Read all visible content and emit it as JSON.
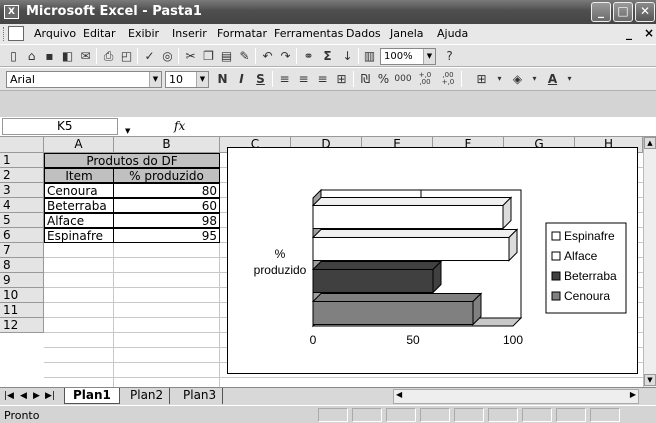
{
  "window": {
    "title": "Microsoft Excel - Pasta1",
    "app_icon": "excel-icon"
  },
  "menu": {
    "items": [
      "Arquivo",
      "Editar",
      "Exibir",
      "Inserir",
      "Formatar",
      "Ferramentas",
      "Dados",
      "Janela",
      "Ajuda"
    ],
    "right_controls": [
      "_",
      "×"
    ]
  },
  "toolbar_standard": {
    "zoom": "100%",
    "sum_symbol": "Σ"
  },
  "toolbar_format": {
    "font": "Arial",
    "size": "10",
    "bold": "N",
    "italic": "I",
    "underline": "S",
    "percent": "%",
    "thousands": "000",
    "inc_decimals": "+,0 ,00",
    "dec_decimals": ",00 +,0"
  },
  "formula_bar": {
    "name_box": "K5",
    "fx": "fx",
    "content": ""
  },
  "columns": [
    "A",
    "B",
    "C",
    "D",
    "E",
    "F",
    "G",
    "H"
  ],
  "rows": [
    "1",
    "2",
    "3",
    "4",
    "5",
    "6",
    "7",
    "8",
    "9",
    "10",
    "11",
    "12"
  ],
  "sheet": {
    "title": "Produtos do DF",
    "headers": [
      "Item",
      "% produzido"
    ],
    "data": [
      {
        "item": "Cenoura",
        "value": "80"
      },
      {
        "item": "Beterraba",
        "value": "60"
      },
      {
        "item": "Alface",
        "value": "98"
      },
      {
        "item": "Espinafre",
        "value": "95"
      }
    ]
  },
  "chart_data": {
    "type": "bar",
    "orientation": "horizontal",
    "style": "3d-clustered",
    "ylabel_lines": [
      "%",
      "produzido"
    ],
    "categories": [
      "Cenoura",
      "Beterraba",
      "Alface",
      "Espinafre"
    ],
    "values": [
      80,
      60,
      98,
      95
    ],
    "xlim": [
      0,
      100
    ],
    "x_ticks": [
      "0",
      "50",
      "100"
    ],
    "legend": [
      "Espinafre",
      "Alface",
      "Beterraba",
      "Cenoura"
    ],
    "legend_position": "right",
    "colors": {
      "Cenoura": "#808080",
      "Beterraba": "#404040",
      "Alface": "#ffffff",
      "Espinafre": "#ffffff"
    },
    "gridlines": true
  },
  "tabs": [
    "Plan1",
    "Plan2",
    "Plan3"
  ],
  "active_tab": "Plan1",
  "status": "Pronto"
}
